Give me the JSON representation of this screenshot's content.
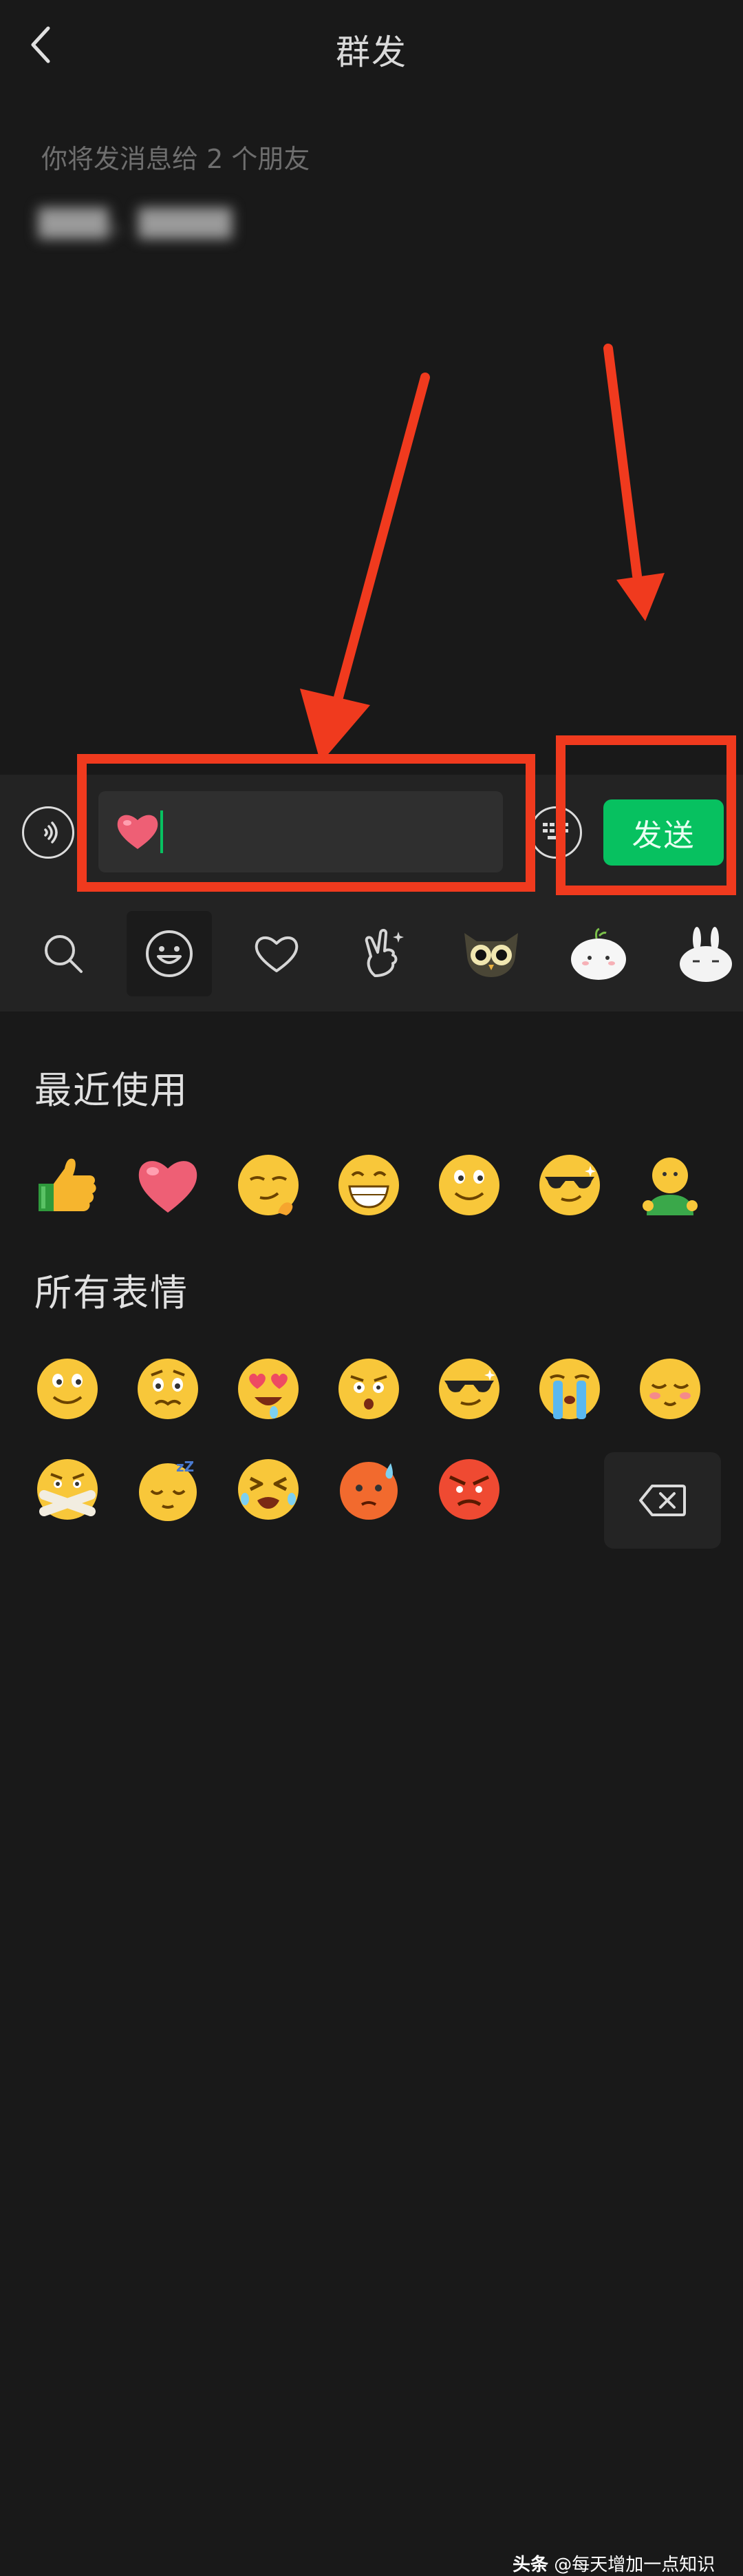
{
  "header": {
    "title": "群发",
    "back_icon": "chevron-left-icon"
  },
  "recipients": {
    "hint": "你将发消息给 2 个朋友",
    "names_blurred": "▇▇▇、▇▇▇▇"
  },
  "input_bar": {
    "voice_icon": "voice-icon",
    "field_content_emoji": "heart-emoji",
    "keyboard_icon": "keyboard-icon",
    "send_label": "发送",
    "send_color": "#07c160"
  },
  "sticker_tabs": [
    {
      "name": "search-icon",
      "active": false
    },
    {
      "name": "smiley-icon",
      "active": true
    },
    {
      "name": "heart-outline-icon",
      "active": false
    },
    {
      "name": "gesture-icon",
      "active": false
    },
    {
      "name": "owl-sticker-icon",
      "active": false
    },
    {
      "name": "rice-ball-sticker-icon",
      "active": false
    },
    {
      "name": "rabbit-sticker-icon",
      "active": false
    }
  ],
  "emoji_panel": {
    "recent_title": "最近使用",
    "recent": [
      "thumbs-up",
      "heart",
      "smirk",
      "grin",
      "smile",
      "cool",
      "green-person"
    ],
    "all_title": "所有表情",
    "all_row1": [
      "smile",
      "worried",
      "heart-eyes",
      "startled",
      "cool",
      "crying",
      "shy"
    ],
    "all_row2": [
      "zip-mouth",
      "sleepy",
      "squint-tears",
      "sweat-red",
      "angry"
    ],
    "backspace_icon": "backspace-icon"
  },
  "annotation_color": "#f03a1e",
  "watermark": {
    "brand": "头条",
    "account": "@每天增加一点知识"
  }
}
